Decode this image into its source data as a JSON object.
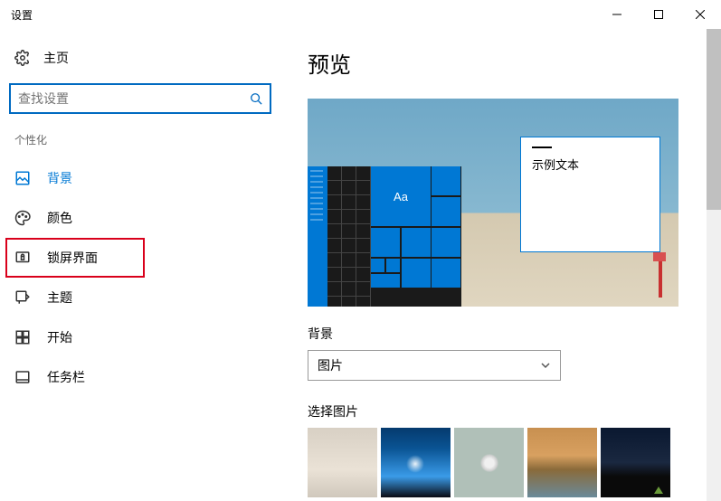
{
  "window": {
    "title": "设置"
  },
  "sidebar": {
    "home": "主页",
    "search_placeholder": "查找设置",
    "category": "个性化",
    "items": [
      {
        "label": "背景"
      },
      {
        "label": "颜色"
      },
      {
        "label": "锁屏界面"
      },
      {
        "label": "主题"
      },
      {
        "label": "开始"
      },
      {
        "label": "任务栏"
      }
    ]
  },
  "main": {
    "preview_heading": "预览",
    "sample_text": "示例文本",
    "tile_text": "Aa",
    "background_label": "背景",
    "background_value": "图片",
    "choose_picture_label": "选择图片"
  }
}
